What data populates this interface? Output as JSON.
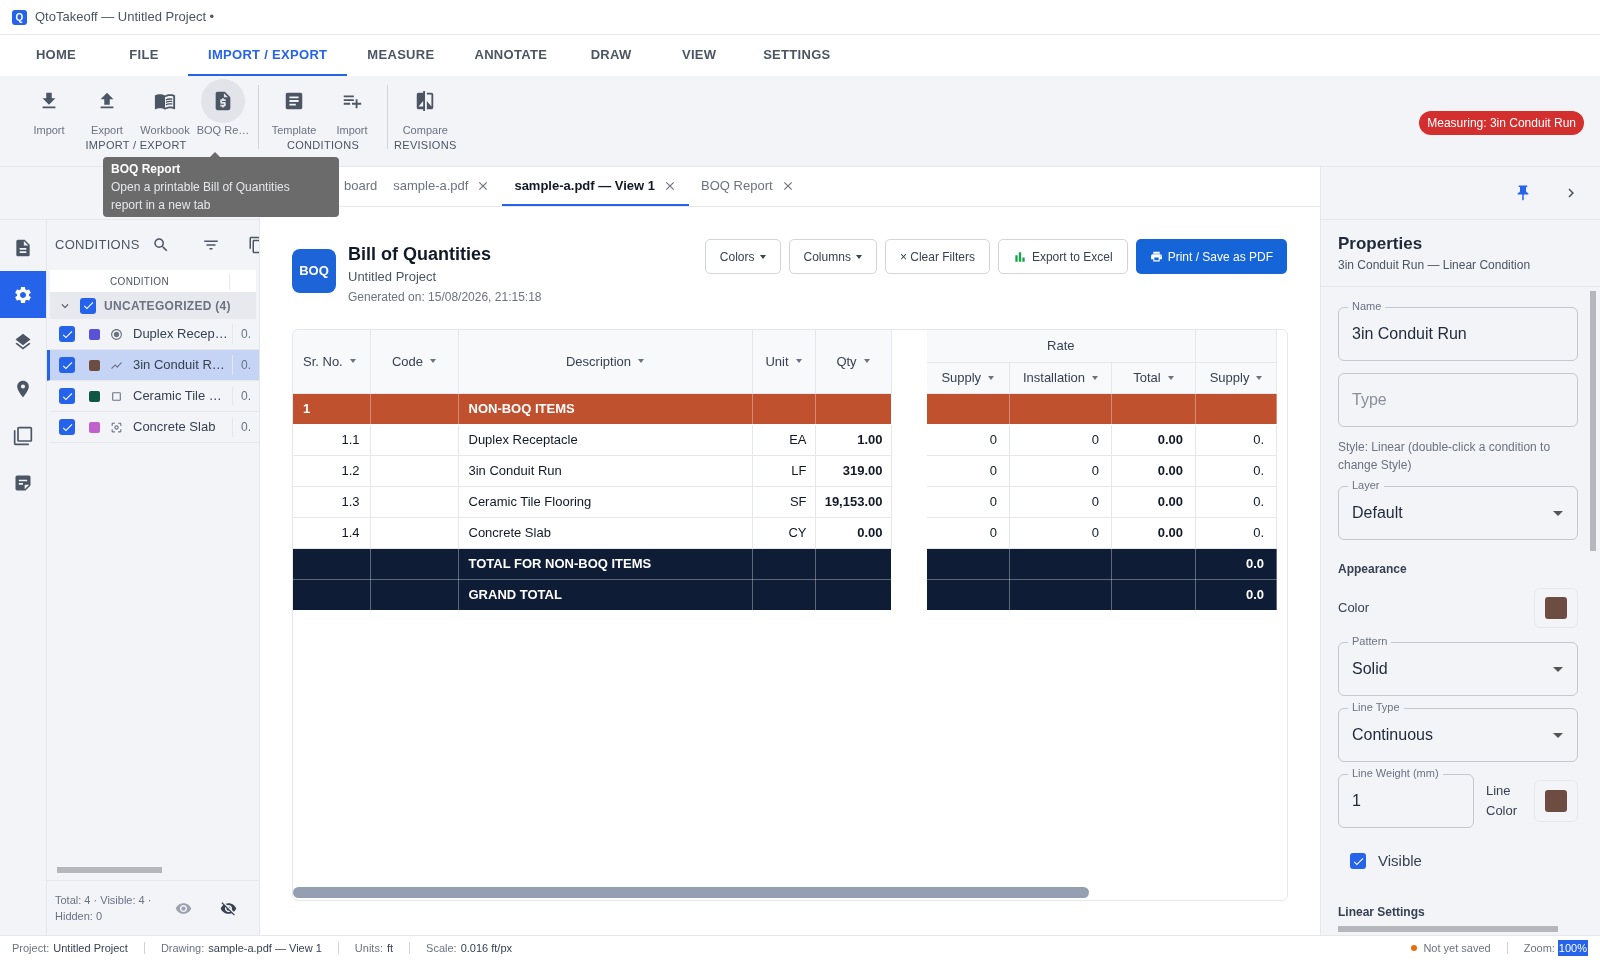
{
  "app": {
    "logo": "Q",
    "title": "QtoTakeoff — Untitled Project •"
  },
  "menu_tabs": [
    {
      "label": "HOME",
      "selected": false
    },
    {
      "label": "FILE",
      "selected": false
    },
    {
      "label": "IMPORT / EXPORT",
      "selected": true
    },
    {
      "label": "MEASURE",
      "selected": false
    },
    {
      "label": "ANNOTATE",
      "selected": false
    },
    {
      "label": "DRAW",
      "selected": false
    },
    {
      "label": "VIEW",
      "selected": false
    },
    {
      "label": "SETTINGS",
      "selected": false
    }
  ],
  "ribbon": {
    "groups": [
      {
        "label": "IMPORT / EXPORT",
        "items": [
          {
            "label": "Import",
            "hovered": false
          },
          {
            "label": "Export",
            "hovered": false
          },
          {
            "label": "Workbook",
            "hovered": false
          },
          {
            "label": "BOQ Re…",
            "hovered": true
          }
        ]
      },
      {
        "label": "CONDITIONS",
        "items": [
          {
            "label": "Template",
            "hovered": false
          },
          {
            "label": "Import",
            "hovered": false
          }
        ]
      },
      {
        "label": "REVISIONS",
        "items": [
          {
            "label": "Compare",
            "hovered": false
          }
        ]
      }
    ],
    "measuring_badge": "Measuring: 3in Conduit Run"
  },
  "tooltip": {
    "title": "BOQ Report",
    "text": "Open a printable Bill of Quantities report in a new tab"
  },
  "rail": [
    {
      "selected": false
    },
    {
      "selected": true
    },
    {
      "selected": false
    },
    {
      "selected": false
    },
    {
      "selected": false
    },
    {
      "selected": false
    }
  ],
  "conditions": {
    "title": "CONDITIONS",
    "column": "CONDITION",
    "group": {
      "label": "UNCATEGORIZED (4)",
      "expanded": true,
      "checked": true
    },
    "items": [
      {
        "name": "Duplex Recep…",
        "color": "#5a51d9",
        "checked": true,
        "selected": false,
        "value": "0."
      },
      {
        "name": "3in Conduit R…",
        "color": "#6d4c41",
        "checked": true,
        "selected": true,
        "value": "0."
      },
      {
        "name": "Ceramic Tile …",
        "color": "#0d5744",
        "checked": true,
        "selected": false,
        "value": "0."
      },
      {
        "name": "Concrete Slab",
        "color": "#c062c9",
        "checked": true,
        "selected": false,
        "value": "0."
      }
    ],
    "footer": "Total: 4 · Visible: 4 · Hidden: 0"
  },
  "doc_tabs": [
    {
      "label": "board",
      "selected": false
    },
    {
      "label": "sample-a.pdf",
      "selected": false
    },
    {
      "label": "sample-a.pdf — View 1",
      "selected": true
    },
    {
      "label": "BOQ Report",
      "selected": false
    }
  ],
  "report": {
    "logo": "BOQ",
    "title": "Bill of Quantities",
    "project": "Untitled Project",
    "generated": "Generated on: 15/08/2026, 21:15:18",
    "buttons": [
      {
        "label": "Colors",
        "kind": "menu"
      },
      {
        "label": "Columns",
        "kind": "menu"
      },
      {
        "label": "× Clear Filters",
        "kind": "plain"
      },
      {
        "label": "Export to Excel",
        "kind": "excel"
      },
      {
        "label": "Print / Save as PDF",
        "kind": "primary"
      }
    ],
    "table": {
      "left_columns": [
        "Sr. No.",
        "Code",
        "Description",
        "Unit",
        "Qty"
      ],
      "group": "Rate",
      "group_columns": [
        "Supply",
        "Installation",
        "Total"
      ],
      "extra_column": "Supply",
      "rows": [
        {
          "kind": "section",
          "sr": "1",
          "description": "NON-BOQ ITEMS"
        },
        {
          "kind": "item",
          "sr": "1.1",
          "description": "Duplex Receptacle",
          "unit": "EA",
          "qty": "1.00",
          "supply": "0",
          "installation": "0",
          "total": "0.00",
          "extra": "0."
        },
        {
          "kind": "item",
          "sr": "1.2",
          "description": "3in Conduit Run",
          "unit": "LF",
          "qty": "319.00",
          "supply": "0",
          "installation": "0",
          "total": "0.00",
          "extra": "0."
        },
        {
          "kind": "item",
          "sr": "1.3",
          "description": "Ceramic Tile Flooring",
          "unit": "SF",
          "qty": "19,153.00",
          "supply": "0",
          "installation": "0",
          "total": "0.00",
          "extra": "0."
        },
        {
          "kind": "item",
          "sr": "1.4",
          "description": "Concrete Slab",
          "unit": "CY",
          "qty": "0.00",
          "supply": "0",
          "installation": "0",
          "total": "0.00",
          "extra": "0."
        },
        {
          "kind": "total",
          "description": "TOTAL FOR NON-BOQ ITEMS",
          "extra": "0.0"
        },
        {
          "kind": "total",
          "description": "GRAND TOTAL",
          "extra": "0.0"
        }
      ]
    }
  },
  "properties": {
    "title": "Properties",
    "subtitle": "3in Conduit Run — Linear Condition",
    "name": {
      "label": "Name",
      "value": "3in Conduit Run"
    },
    "type": {
      "placeholder": "Type"
    },
    "style_hint": "Style: Linear (double-click a condition to change Style)",
    "layer": {
      "label": "Layer",
      "value": "Default"
    },
    "appearance": "Appearance",
    "color": {
      "label": "Color",
      "color": "#6d4c41"
    },
    "pattern": {
      "label": "Pattern",
      "value": "Solid"
    },
    "line_type": {
      "label": "Line Type",
      "value": "Continuous"
    },
    "line_weight": {
      "label": "Line Weight (mm)",
      "value": "1"
    },
    "line_color": {
      "label": "Line Color",
      "color": "#6d4c41"
    },
    "visible": {
      "label": "Visible",
      "checked": true
    },
    "linear_settings": "Linear Settings"
  },
  "status_bar": {
    "items": [
      {
        "label": "Project:",
        "value": "Untitled Project"
      },
      {
        "label": "Drawing:",
        "value": "sample-a.pdf — View 1"
      },
      {
        "label": "Units:",
        "value": "ft"
      },
      {
        "label": "Scale:",
        "value": "0.016 ft/px"
      }
    ],
    "save_status": "Not yet saved",
    "saved": false,
    "zoom_label": "Zoom:",
    "zoom": "100%"
  }
}
